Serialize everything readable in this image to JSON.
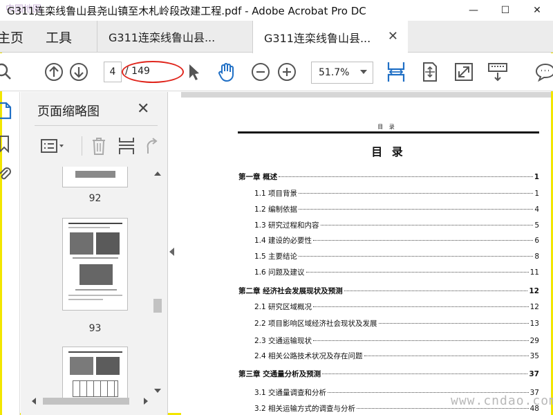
{
  "window": {
    "title": "G311连栾线鲁山县尧山镇至木札岭段改建工程.pdf - Adobe Acrobat Pro DC",
    "watermark_logo": "中国地图",
    "controls": [
      "—",
      "☐",
      "✕"
    ]
  },
  "tabs": {
    "home": "主页",
    "tools": "工具",
    "docs": [
      {
        "label": "G311连栾线鲁山县...",
        "active": false
      },
      {
        "label": "G311连栾线鲁山县...",
        "active": true
      }
    ],
    "close_glyph": "✕"
  },
  "toolbar": {
    "current_page": "4",
    "total_pages": "/ 149",
    "zoom": "51.7%",
    "icons": [
      "search-icon",
      "page-up-icon",
      "page-down-icon",
      "select-cursor-icon",
      "hand-tool-icon",
      "zoom-out-icon",
      "zoom-in-icon",
      "fit-width-icon",
      "fit-page-icon",
      "full-screen-icon",
      "keyboard-icon",
      "comment-icon"
    ]
  },
  "colors": {
    "accent": "#1f6fc5",
    "annotation": "#e0261d",
    "frame": "#f2e600"
  },
  "panel": {
    "title": "页面缩略图",
    "close_glyph": "✕",
    "thumbnails": [
      {
        "number": "92"
      },
      {
        "number": "93"
      }
    ]
  },
  "document": {
    "running_head": "目  录",
    "toc_title": "目 录",
    "entries": [
      {
        "level": 1,
        "text": "第一章  概述",
        "page": "1"
      },
      {
        "level": 2,
        "text": "1.1  项目背景",
        "page": "1"
      },
      {
        "level": 2,
        "text": "1.2  编制依据",
        "page": "4"
      },
      {
        "level": 2,
        "text": "1.3  研究过程和内容",
        "page": "5"
      },
      {
        "level": 2,
        "text": "1.4  建设的必要性",
        "page": "6"
      },
      {
        "level": 2,
        "text": "1.5 主要结论",
        "page": "8"
      },
      {
        "level": 2,
        "text": "1.6 问题及建议",
        "page": "11"
      },
      {
        "level": 1,
        "text": "第二章  经济社会发展现状及预测",
        "page": "12"
      },
      {
        "level": 2,
        "text": "2.1 研究区域概况",
        "page": "12"
      },
      {
        "level": 2,
        "text": "2.2 项目影响区域经济社会现状及发展",
        "page": "13"
      },
      {
        "level": 2,
        "text": "2.3  交通运输现状",
        "page": "29"
      },
      {
        "level": 2,
        "text": "2.4  相关公路技术状况及存在问题",
        "page": "35"
      },
      {
        "level": 1,
        "text": "第三章  交通量分析及预测",
        "page": "37"
      },
      {
        "level": 2,
        "text": "3.1  交通量调查和分析",
        "page": "37"
      },
      {
        "level": 2,
        "text": "3.2 相关运输方式的调查与分析",
        "page": "48"
      }
    ]
  },
  "site_watermark": "www.cndao.com"
}
